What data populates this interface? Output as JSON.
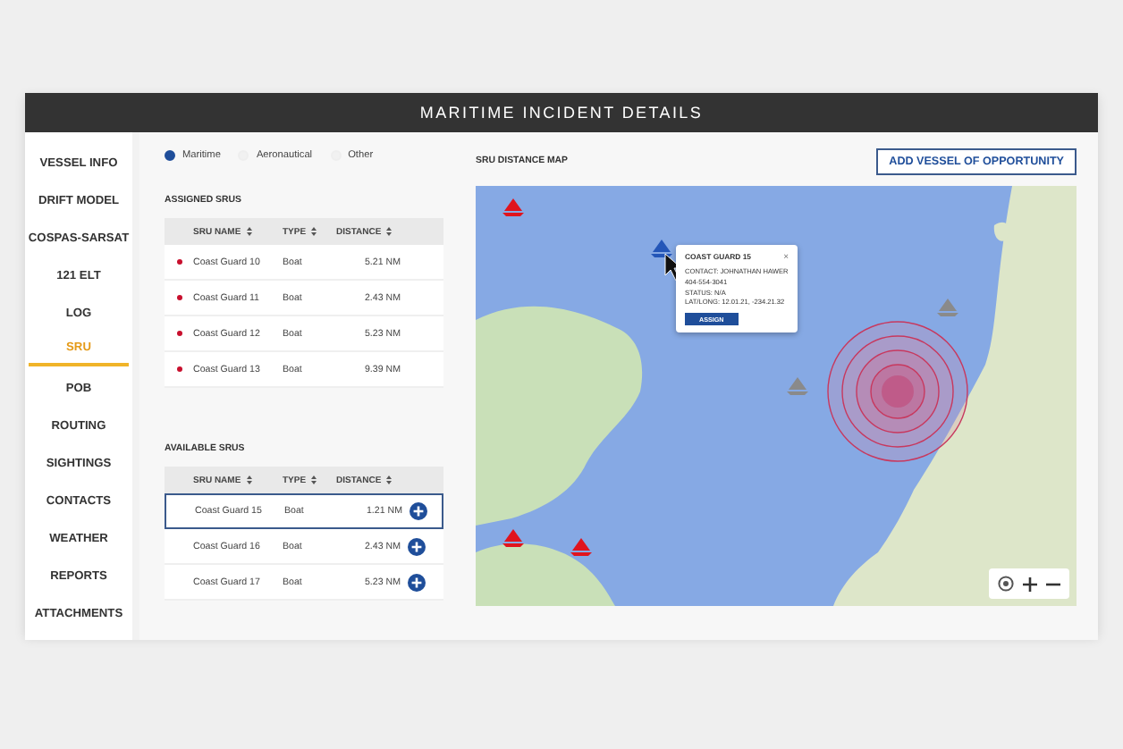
{
  "window": {
    "title": "MARITIME INCIDENT DETAILS"
  },
  "sidebar": {
    "items": [
      {
        "label": "VESSEL INFO",
        "selected": false
      },
      {
        "label": "DRIFT MODEL",
        "selected": false
      },
      {
        "label": "COSPAS-SARSAT",
        "selected": false
      },
      {
        "label": "121 ELT",
        "selected": false
      },
      {
        "label": "LOG",
        "selected": false
      },
      {
        "label": "SRU",
        "selected": true
      },
      {
        "label": "POB",
        "selected": false
      },
      {
        "label": "ROUTING",
        "selected": false
      },
      {
        "label": "SIGHTINGS",
        "selected": false
      },
      {
        "label": "CONTACTS",
        "selected": false
      },
      {
        "label": "WEATHER",
        "selected": false
      },
      {
        "label": "REPORTS",
        "selected": false
      },
      {
        "label": "ATTACHMENTS",
        "selected": false
      }
    ]
  },
  "incident_type": {
    "options": [
      {
        "label": "Maritime",
        "selected": true
      },
      {
        "label": "Aeronautical",
        "selected": false
      },
      {
        "label": "Other",
        "selected": false
      }
    ]
  },
  "assigned_srus": {
    "title": "ASSIGNED SRUS",
    "columns": [
      "SRU NAME",
      "TYPE",
      "DISTANCE"
    ],
    "rows": [
      {
        "name": "Coast Guard 10",
        "type": "Boat",
        "distance": "5.21 NM"
      },
      {
        "name": "Coast Guard 11",
        "type": "Boat",
        "distance": "2.43 NM"
      },
      {
        "name": "Coast Guard 12",
        "type": "Boat",
        "distance": "5.23 NM"
      },
      {
        "name": "Coast Guard 13",
        "type": "Boat",
        "distance": "9.39 NM"
      }
    ]
  },
  "available_srus": {
    "title": "AVAILABLE SRUS",
    "columns": [
      "SRU NAME",
      "TYPE",
      "DISTANCE"
    ],
    "rows": [
      {
        "name": "Coast Guard 15",
        "type": "Boat",
        "distance": "1.21 NM",
        "selected": true
      },
      {
        "name": "Coast Guard 16",
        "type": "Boat",
        "distance": "2.43 NM",
        "selected": false
      },
      {
        "name": "Coast Guard 17",
        "type": "Boat",
        "distance": "5.23 NM",
        "selected": false
      }
    ]
  },
  "map": {
    "title": "SRU DISTANCE MAP",
    "add_button": "ADD VESSEL OF OPPORTUNITY",
    "popup": {
      "title": "COAST GUARD 15",
      "close": "×",
      "lines": [
        "CONTACT: JOHNATHAN HAWER",
        "404-554-3041",
        "STATUS: N/A",
        "LAT/LONG: 12.01.21, -234.21.32"
      ],
      "button": "ASSIGN"
    }
  }
}
